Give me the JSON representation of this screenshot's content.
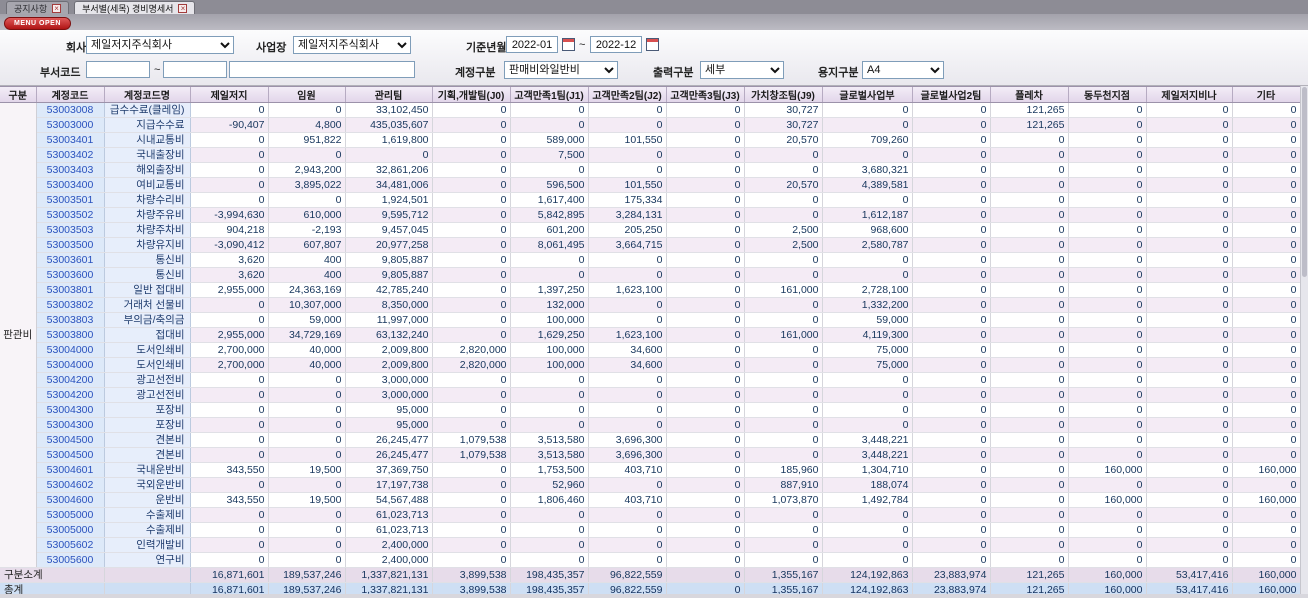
{
  "colors": {
    "accent_red": "#b01414",
    "tab_bar": "#8d8c95",
    "header_bg": "#e2d6ea",
    "stripe_bg": "#f4ebf5",
    "code_bg": "#dde9f9",
    "code_text": "#2a52be",
    "name_bg": "#e7eefb",
    "num_text": "#17365d",
    "subtotal_bg": "#e7dcea",
    "total_bg": "#cedff4"
  },
  "tabs": [
    {
      "label": "공지사항"
    },
    {
      "label": "부서별(세목) 경비명세서"
    }
  ],
  "menu_open_label": "MENU OPEN",
  "filters": {
    "company_label": "회사",
    "company_value": "제일저지주식회사",
    "workplace_label": "사업장",
    "workplace_value": "제일저지주식회사",
    "period_label": "기준년월",
    "period_from": "2022-01",
    "period_to": "2022-12",
    "tilde": "~",
    "dept_code_label": "부서코드",
    "dept_from": "",
    "dept_to": "",
    "dept_name": "",
    "account_type_label": "계정구분",
    "account_type_value": "판매비와일반비",
    "output_type_label": "출력구분",
    "output_type_value": "세부",
    "paper_label": "용지구분",
    "paper_value": "A4"
  },
  "table": {
    "headers": [
      "구분",
      "계정코드",
      "계정코드명",
      "제일저지",
      "임원",
      "관리팀",
      "기획,개발팀(J0)",
      "고객만족1팀(J1)",
      "고객만족2팀(J2)",
      "고객만족3팀(J3)",
      "가치창조팀(J9)",
      "글로벌사업부",
      "글로벌사업2팀",
      "플레차",
      "동두천지점",
      "제일저지비나",
      "기타"
    ],
    "group_label": "판관비",
    "rows": [
      {
        "code": "53003008",
        "name": "급수수료(클레임)",
        "values": [
          "0",
          "0",
          "33,102,450",
          "0",
          "0",
          "0",
          "0",
          "30,727",
          "0",
          "0",
          "121,265",
          "0",
          "0",
          "0"
        ]
      },
      {
        "code": "53003000",
        "name": "지급수수료",
        "values": [
          "-90,407",
          "4,800",
          "435,035,607",
          "0",
          "0",
          "0",
          "0",
          "30,727",
          "0",
          "0",
          "121,265",
          "0",
          "0",
          "0"
        ]
      },
      {
        "code": "53003401",
        "name": "시내교통비",
        "values": [
          "0",
          "951,822",
          "1,619,800",
          "0",
          "589,000",
          "101,550",
          "0",
          "20,570",
          "709,260",
          "0",
          "0",
          "0",
          "0",
          "0"
        ]
      },
      {
        "code": "53003402",
        "name": "국내출장비",
        "values": [
          "0",
          "0",
          "0",
          "0",
          "7,500",
          "0",
          "0",
          "0",
          "0",
          "0",
          "0",
          "0",
          "0",
          "0"
        ]
      },
      {
        "code": "53003403",
        "name": "해외출장비",
        "values": [
          "0",
          "2,943,200",
          "32,861,206",
          "0",
          "0",
          "0",
          "0",
          "0",
          "3,680,321",
          "0",
          "0",
          "0",
          "0",
          "0"
        ]
      },
      {
        "code": "53003400",
        "name": "여비교통비",
        "values": [
          "0",
          "3,895,022",
          "34,481,006",
          "0",
          "596,500",
          "101,550",
          "0",
          "20,570",
          "4,389,581",
          "0",
          "0",
          "0",
          "0",
          "0"
        ]
      },
      {
        "code": "53003501",
        "name": "차량수리비",
        "values": [
          "0",
          "0",
          "1,924,501",
          "0",
          "1,617,400",
          "175,334",
          "0",
          "0",
          "0",
          "0",
          "0",
          "0",
          "0",
          "0"
        ]
      },
      {
        "code": "53003502",
        "name": "차량주유비",
        "values": [
          "-3,994,630",
          "610,000",
          "9,595,712",
          "0",
          "5,842,895",
          "3,284,131",
          "0",
          "0",
          "1,612,187",
          "0",
          "0",
          "0",
          "0",
          "0"
        ]
      },
      {
        "code": "53003503",
        "name": "차량주차비",
        "values": [
          "904,218",
          "-2,193",
          "9,457,045",
          "0",
          "601,200",
          "205,250",
          "0",
          "2,500",
          "968,600",
          "0",
          "0",
          "0",
          "0",
          "0"
        ]
      },
      {
        "code": "53003500",
        "name": "차량유지비",
        "values": [
          "-3,090,412",
          "607,807",
          "20,977,258",
          "0",
          "8,061,495",
          "3,664,715",
          "0",
          "2,500",
          "2,580,787",
          "0",
          "0",
          "0",
          "0",
          "0"
        ]
      },
      {
        "code": "53003601",
        "name": "통신비",
        "values": [
          "3,620",
          "400",
          "9,805,887",
          "0",
          "0",
          "0",
          "0",
          "0",
          "0",
          "0",
          "0",
          "0",
          "0",
          "0"
        ]
      },
      {
        "code": "53003600",
        "name": "통신비",
        "values": [
          "3,620",
          "400",
          "9,805,887",
          "0",
          "0",
          "0",
          "0",
          "0",
          "0",
          "0",
          "0",
          "0",
          "0",
          "0"
        ]
      },
      {
        "code": "53003801",
        "name": "일반 접대비",
        "values": [
          "2,955,000",
          "24,363,169",
          "42,785,240",
          "0",
          "1,397,250",
          "1,623,100",
          "0",
          "161,000",
          "2,728,100",
          "0",
          "0",
          "0",
          "0",
          "0"
        ]
      },
      {
        "code": "53003802",
        "name": "거래처 선물비",
        "values": [
          "0",
          "10,307,000",
          "8,350,000",
          "0",
          "132,000",
          "0",
          "0",
          "0",
          "1,332,200",
          "0",
          "0",
          "0",
          "0",
          "0"
        ]
      },
      {
        "code": "53003803",
        "name": "부의금/축의금",
        "values": [
          "0",
          "59,000",
          "11,997,000",
          "0",
          "100,000",
          "0",
          "0",
          "0",
          "59,000",
          "0",
          "0",
          "0",
          "0",
          "0"
        ]
      },
      {
        "code": "53003800",
        "name": "접대비",
        "values": [
          "2,955,000",
          "34,729,169",
          "63,132,240",
          "0",
          "1,629,250",
          "1,623,100",
          "0",
          "161,000",
          "4,119,300",
          "0",
          "0",
          "0",
          "0",
          "0"
        ]
      },
      {
        "code": "53004000",
        "name": "도서인쇄비",
        "values": [
          "2,700,000",
          "40,000",
          "2,009,800",
          "2,820,000",
          "100,000",
          "34,600",
          "0",
          "0",
          "75,000",
          "0",
          "0",
          "0",
          "0",
          "0"
        ]
      },
      {
        "code": "53004000",
        "name": "도서인쇄비",
        "values": [
          "2,700,000",
          "40,000",
          "2,009,800",
          "2,820,000",
          "100,000",
          "34,600",
          "0",
          "0",
          "75,000",
          "0",
          "0",
          "0",
          "0",
          "0"
        ]
      },
      {
        "code": "53004200",
        "name": "광고선전비",
        "values": [
          "0",
          "0",
          "3,000,000",
          "0",
          "0",
          "0",
          "0",
          "0",
          "0",
          "0",
          "0",
          "0",
          "0",
          "0"
        ]
      },
      {
        "code": "53004200",
        "name": "광고선전비",
        "values": [
          "0",
          "0",
          "3,000,000",
          "0",
          "0",
          "0",
          "0",
          "0",
          "0",
          "0",
          "0",
          "0",
          "0",
          "0"
        ]
      },
      {
        "code": "53004300",
        "name": "포장비",
        "values": [
          "0",
          "0",
          "95,000",
          "0",
          "0",
          "0",
          "0",
          "0",
          "0",
          "0",
          "0",
          "0",
          "0",
          "0"
        ]
      },
      {
        "code": "53004300",
        "name": "포장비",
        "values": [
          "0",
          "0",
          "95,000",
          "0",
          "0",
          "0",
          "0",
          "0",
          "0",
          "0",
          "0",
          "0",
          "0",
          "0"
        ]
      },
      {
        "code": "53004500",
        "name": "견본비",
        "values": [
          "0",
          "0",
          "26,245,477",
          "1,079,538",
          "3,513,580",
          "3,696,300",
          "0",
          "0",
          "3,448,221",
          "0",
          "0",
          "0",
          "0",
          "0"
        ]
      },
      {
        "code": "53004500",
        "name": "견본비",
        "values": [
          "0",
          "0",
          "26,245,477",
          "1,079,538",
          "3,513,580",
          "3,696,300",
          "0",
          "0",
          "3,448,221",
          "0",
          "0",
          "0",
          "0",
          "0"
        ]
      },
      {
        "code": "53004601",
        "name": "국내운반비",
        "values": [
          "343,550",
          "19,500",
          "37,369,750",
          "0",
          "1,753,500",
          "403,710",
          "0",
          "185,960",
          "1,304,710",
          "0",
          "0",
          "160,000",
          "0",
          "160,000"
        ]
      },
      {
        "code": "53004602",
        "name": "국외운반비",
        "values": [
          "0",
          "0",
          "17,197,738",
          "0",
          "52,960",
          "0",
          "0",
          "887,910",
          "188,074",
          "0",
          "0",
          "0",
          "0",
          "0"
        ]
      },
      {
        "code": "53004600",
        "name": "운반비",
        "values": [
          "343,550",
          "19,500",
          "54,567,488",
          "0",
          "1,806,460",
          "403,710",
          "0",
          "1,073,870",
          "1,492,784",
          "0",
          "0",
          "160,000",
          "0",
          "160,000"
        ]
      },
      {
        "code": "53005000",
        "name": "수출제비",
        "values": [
          "0",
          "0",
          "61,023,713",
          "0",
          "0",
          "0",
          "0",
          "0",
          "0",
          "0",
          "0",
          "0",
          "0",
          "0"
        ]
      },
      {
        "code": "53005000",
        "name": "수출제비",
        "values": [
          "0",
          "0",
          "61,023,713",
          "0",
          "0",
          "0",
          "0",
          "0",
          "0",
          "0",
          "0",
          "0",
          "0",
          "0"
        ]
      },
      {
        "code": "53005602",
        "name": "인력개발비",
        "values": [
          "0",
          "0",
          "2,400,000",
          "0",
          "0",
          "0",
          "0",
          "0",
          "0",
          "0",
          "0",
          "0",
          "0",
          "0"
        ]
      },
      {
        "code": "53005600",
        "name": "연구비",
        "values": [
          "0",
          "0",
          "2,400,000",
          "0",
          "0",
          "0",
          "0",
          "0",
          "0",
          "0",
          "0",
          "0",
          "0",
          "0"
        ]
      }
    ],
    "subtotal": {
      "label": "구분소계",
      "values": [
        "16,871,601",
        "189,537,246",
        "1,337,821,131",
        "3,899,538",
        "198,435,357",
        "96,822,559",
        "0",
        "1,355,167",
        "124,192,863",
        "23,883,974",
        "121,265",
        "160,000",
        "53,417,416",
        "160,000"
      ]
    },
    "total": {
      "label": "총계",
      "values": [
        "16,871,601",
        "189,537,246",
        "1,337,821,131",
        "3,899,538",
        "198,435,357",
        "96,822,559",
        "0",
        "1,355,167",
        "124,192,863",
        "23,883,974",
        "121,265",
        "160,000",
        "53,417,416",
        "160,000"
      ]
    }
  }
}
